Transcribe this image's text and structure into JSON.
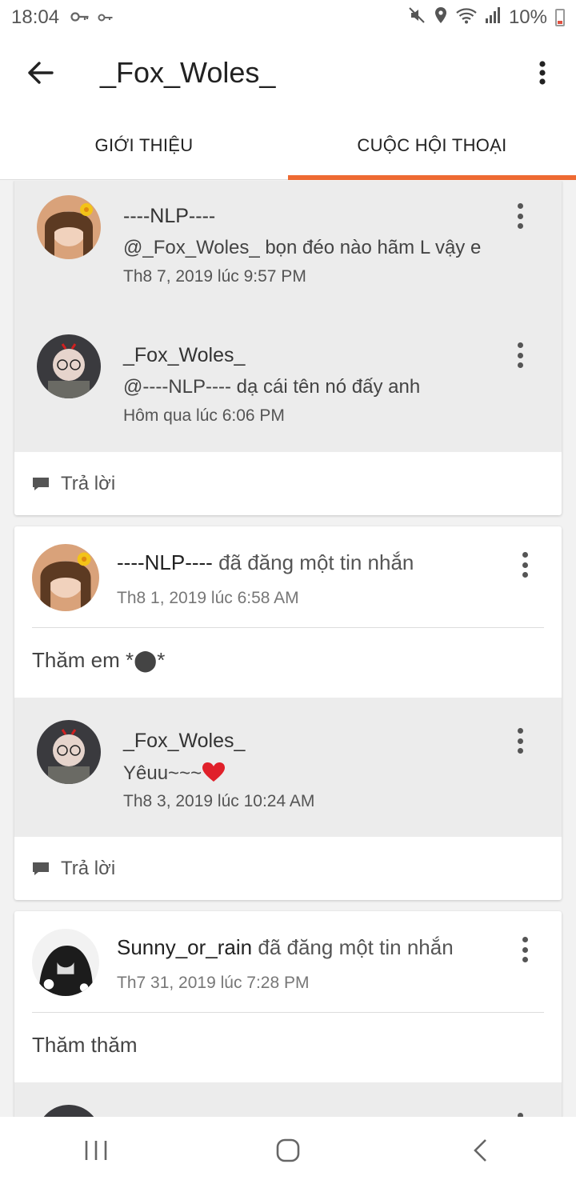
{
  "status": {
    "time": "18:04",
    "battery": "10%"
  },
  "appbar": {
    "title": "_Fox_Woles_"
  },
  "tabs": [
    {
      "label": "GIỚI THIỆU"
    },
    {
      "label": "CUỘC HỘI THOẠI"
    }
  ],
  "cards": [
    {
      "comments": [
        {
          "name": "----NLP----",
          "text": "@_Fox_Woles_ bọn đéo nào hãm L vậy e",
          "time": "Th8 7, 2019 lúc 9:57 PM"
        },
        {
          "name": "_Fox_Woles_",
          "text": "@----NLP----  dạ cái tên nó đấy anh",
          "time": "Hôm qua lúc 6:06 PM"
        }
      ],
      "reply_label": "Trả lời"
    },
    {
      "author": "----NLP----",
      "action": "đã đăng một tin nhắn",
      "time": "Th8 1, 2019 lúc 6:58 AM",
      "body": "Thăm em *⬤*",
      "comments": [
        {
          "name": "_Fox_Woles_",
          "text": "Yêuu~~~",
          "time": "Th8 3, 2019 lúc 10:24 AM"
        }
      ],
      "reply_label": "Trả lời"
    },
    {
      "author": "Sunny_or_rain",
      "action": "đã đăng một tin nhắn",
      "time": "Th7 31, 2019 lúc 7:28 PM",
      "body": "Thăm thăm"
    }
  ],
  "colors": {
    "accent": "#ee6a32",
    "reply_bg": "#ececec",
    "heart": "#e0202a"
  }
}
